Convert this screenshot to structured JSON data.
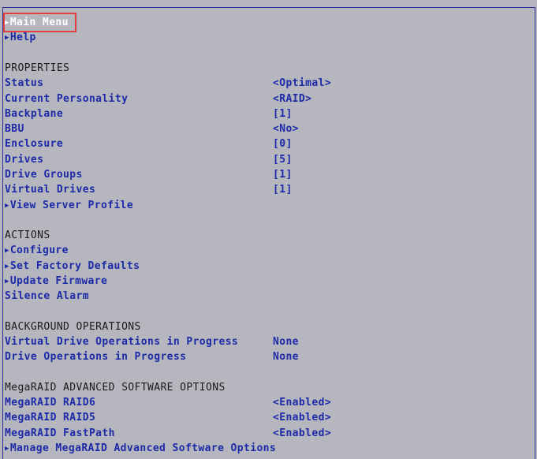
{
  "nav": {
    "main_menu": "Main Menu",
    "help": "Help"
  },
  "properties": {
    "header": "PROPERTIES",
    "items": [
      {
        "label": "Status",
        "value": "<Optimal>"
      },
      {
        "label": "Current Personality",
        "value": "<RAID>"
      },
      {
        "label": "Backplane",
        "value": "[1]"
      },
      {
        "label": "BBU",
        "value": "<No>"
      },
      {
        "label": "Enclosure",
        "value": "[0]"
      },
      {
        "label": "Drives",
        "value": "[5]"
      },
      {
        "label": "Drive Groups",
        "value": "[1]"
      },
      {
        "label": "Virtual Drives",
        "value": "[1]"
      }
    ],
    "link": "View Server Profile"
  },
  "actions": {
    "header": "ACTIONS",
    "configure": "Configure",
    "set_factory_defaults": "Set Factory Defaults",
    "update_firmware": "Update Firmware",
    "silence_alarm": "Silence Alarm"
  },
  "background": {
    "header": "BACKGROUND OPERATIONS",
    "items": [
      {
        "label": "Virtual Drive Operations in Progress",
        "value": "None"
      },
      {
        "label": "Drive Operations in Progress",
        "value": "None"
      }
    ]
  },
  "advanced": {
    "header": "MegaRAID ADVANCED SOFTWARE OPTIONS",
    "items": [
      {
        "label": "MegaRAID RAID6",
        "value": "<Enabled>"
      },
      {
        "label": "MegaRAID RAID5",
        "value": "<Enabled>"
      },
      {
        "label": "MegaRAID FastPath",
        "value": "<Enabled>"
      }
    ],
    "link": "Manage MegaRAID Advanced Software Options"
  },
  "colors": {
    "background": "#b6b6be",
    "item_text": "#1c2aa8",
    "header_text": "#1a1a1a",
    "selected_text": "#ffffff",
    "highlight_border": "#e04040"
  },
  "icons": {
    "submenu": "triangle-right-icon"
  }
}
